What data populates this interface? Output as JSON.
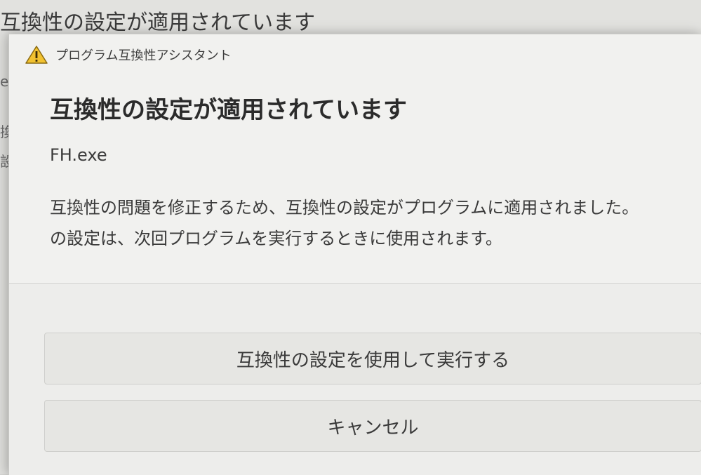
{
  "background": {
    "title": "互換性の設定が適用されています",
    "side_fragments": [
      "e",
      "換",
      "設"
    ]
  },
  "dialog": {
    "window_title": "プログラム互換性アシスタント",
    "title_icon": "warning-icon",
    "heading": "互換性の設定が適用されています",
    "program_name": "FH.exe",
    "message_line1": "互換性の問題を修正するため、互換性の設定がプログラムに適用されました。",
    "message_line2": "の設定は、次回プログラムを実行するときに使用されます。",
    "buttons": {
      "run_label": "互換性の設定を使用して実行する",
      "cancel_label": "キャンセル"
    }
  },
  "colors": {
    "warning_fill": "#f2c230",
    "warning_stroke": "#8a6a10"
  }
}
